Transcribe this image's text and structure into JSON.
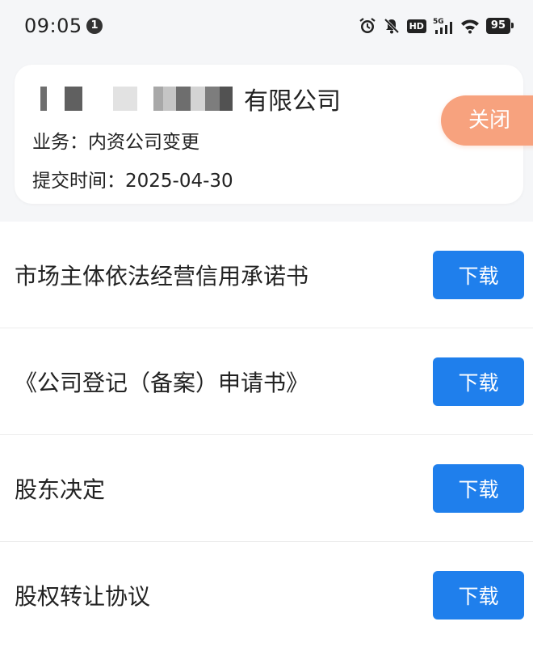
{
  "status_bar": {
    "time": "09:05",
    "notification_count": "1",
    "network": "5G",
    "hd_label": "HD",
    "battery": "95"
  },
  "card": {
    "company_suffix": "有限公司",
    "business": "业务：内资公司变更",
    "submit_time": "提交时间：2025-04-30"
  },
  "close_label": "关闭",
  "documents": [
    {
      "title": "市场主体依法经营信用承诺书",
      "button": "下载"
    },
    {
      "title": "《公司登记（备案）申请书》",
      "button": "下载"
    },
    {
      "title": "股东决定",
      "button": "下载"
    },
    {
      "title": "股权转让协议",
      "button": "下载"
    }
  ],
  "colors": {
    "accent_blue": "#1f7fec",
    "close_orange": "#f7a27e",
    "header_bg": "#f5f6f8"
  }
}
